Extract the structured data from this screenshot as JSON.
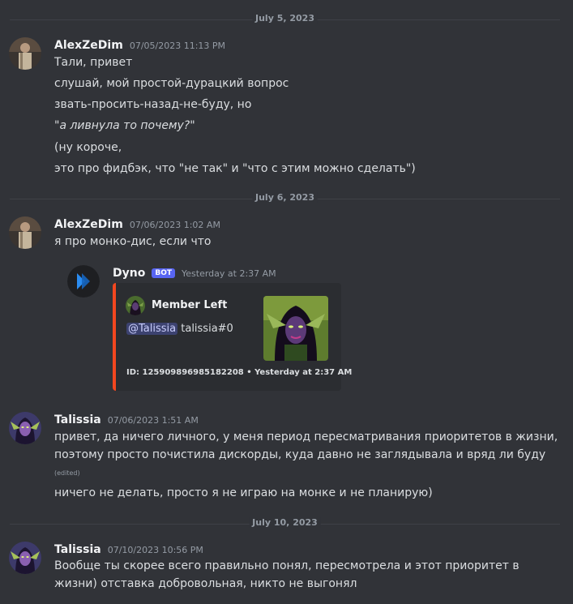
{
  "dividers": [
    "July 5, 2023",
    "July 6, 2023",
    "July 10, 2023"
  ],
  "messages": [
    {
      "author": "AlexZeDim",
      "timestamp": "07/05/2023 11:13 PM",
      "lines": [
        "Тали, привет",
        "слушай, мой простой-дурацкий вопрос",
        "звать-просить-назад-не-буду, но",
        "\"а ливнула то почему?\"",
        "(ну короче,",
        "это про фидбэк, что \"не так\" и \"что с этим можно сделать\")"
      ]
    },
    {
      "author": "AlexZeDim",
      "timestamp": "07/06/2023 1:02 AM",
      "lines": [
        "я про монко-дис, если что"
      ]
    },
    {
      "author": "Talissia",
      "timestamp": "07/06/2023 1:51 AM",
      "lines": [
        "привет, да ничего личного, у меня период пересматривания приоритетов в жизни,",
        "поэтому просто почистила дискорды, куда давно не заглядывала и вряд ли буду",
        "ничего не делать, просто я не играю на монке и не планирую)"
      ],
      "edited": "(edited)"
    },
    {
      "author": "Talissia",
      "timestamp": "07/10/2023 10:56 PM",
      "lines": [
        "Вообще ты скорее всего правильно понял, пересмотрела и этот приоритет в",
        "жизни) отставка добровольная, никто не выгонял"
      ]
    }
  ],
  "bot": {
    "name": "Dyno",
    "badge": "BOT",
    "timestamp": "Yesterday at 2:37 AM",
    "embed": {
      "author": "Member Left",
      "mention": "@Talissia",
      "tag": "talissia#0",
      "footer": "ID: 125909896985182208 • Yesterday at 2:37 AM",
      "accent": "#f2471f"
    }
  },
  "colors": {
    "background": "#313338",
    "blurple": "#5865f2",
    "muted": "#949ba4"
  }
}
